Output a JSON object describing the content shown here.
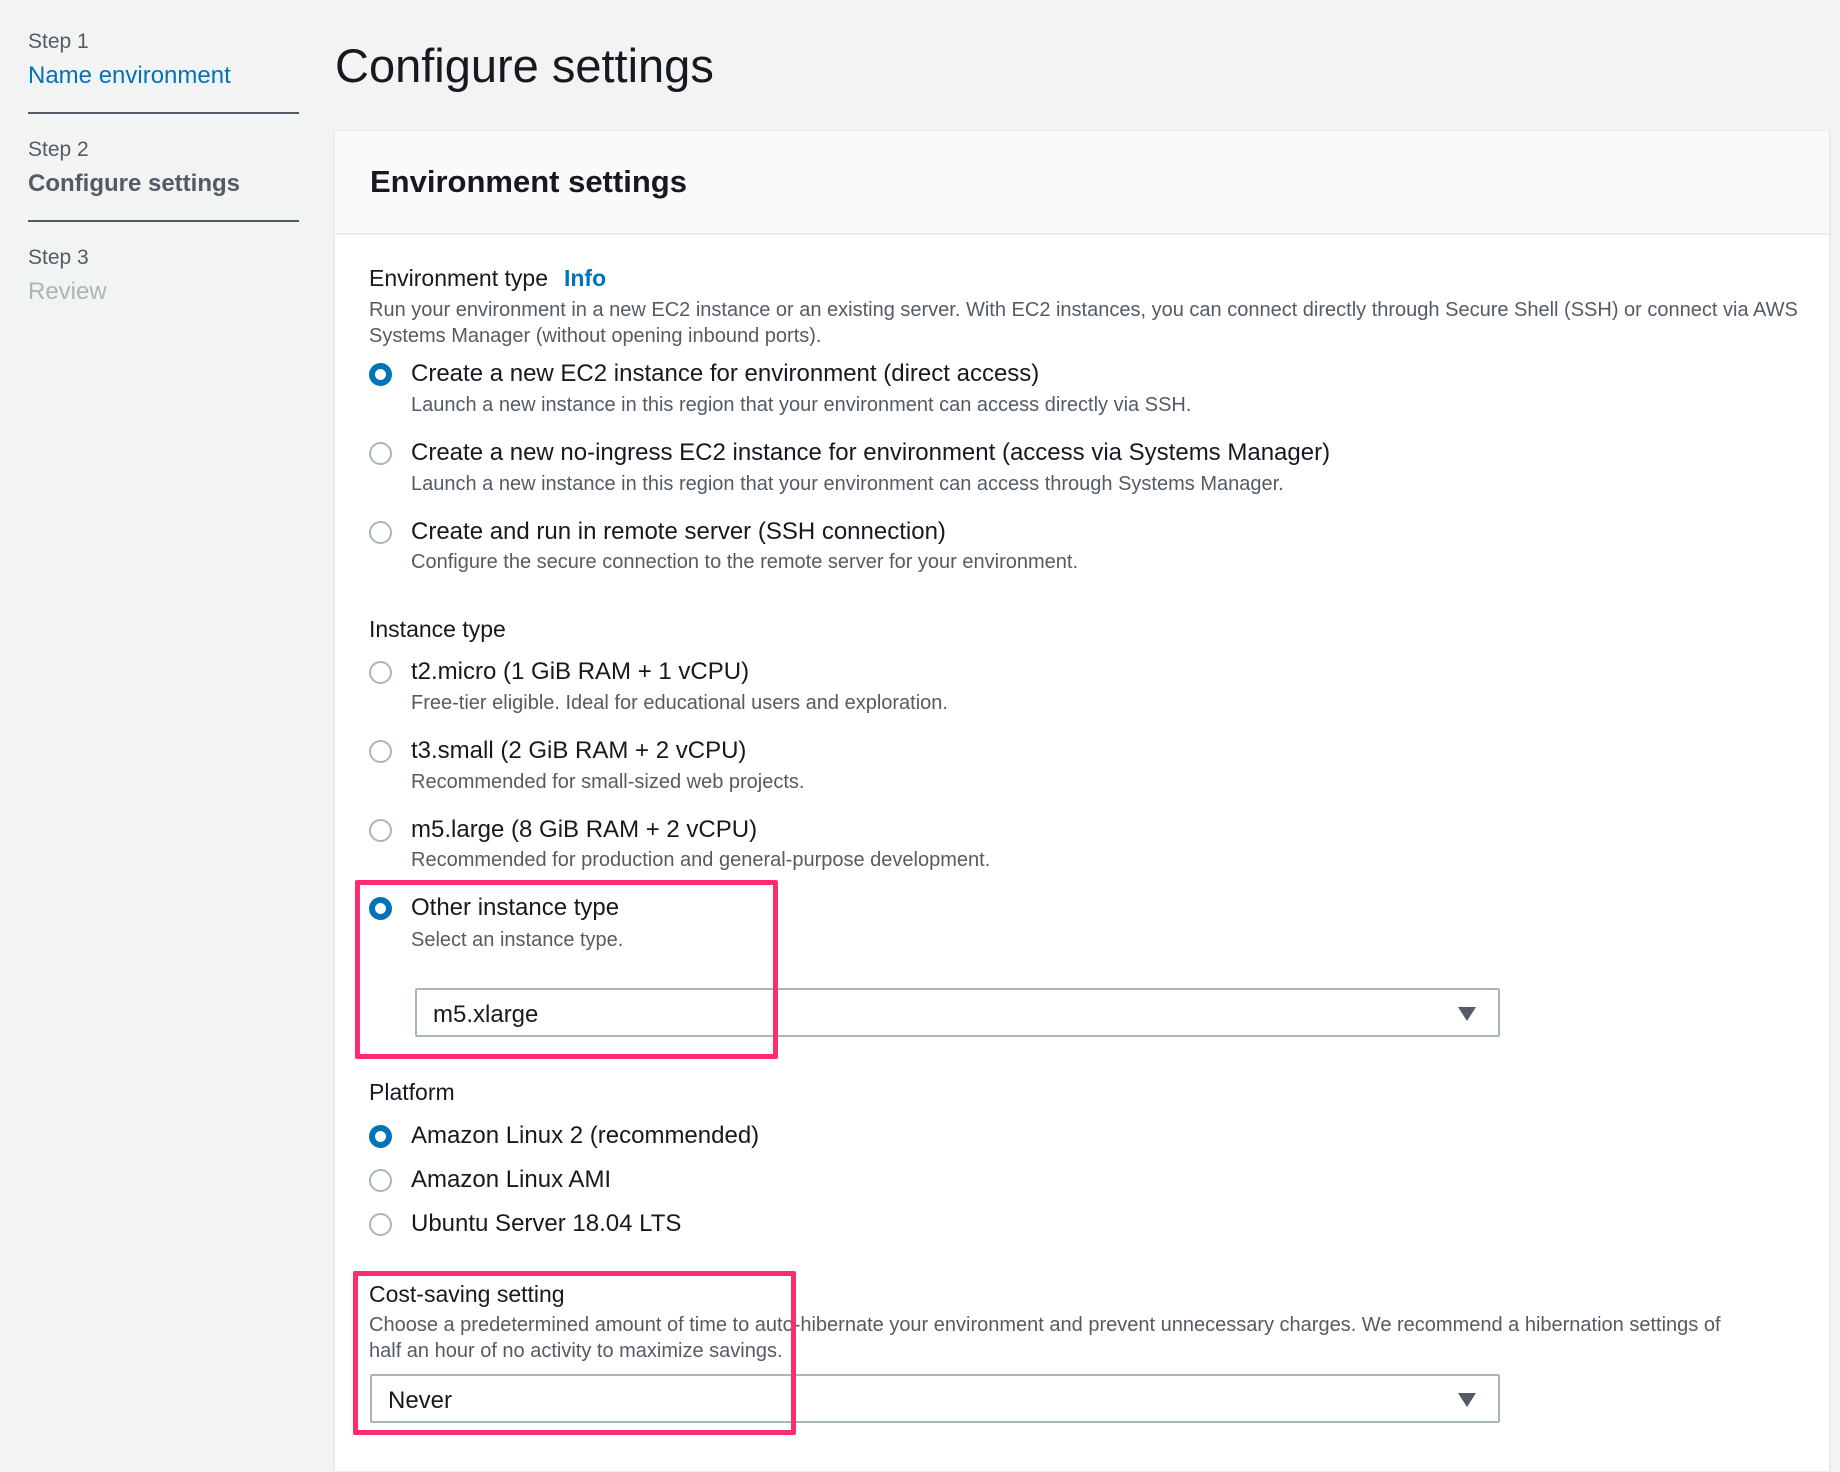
{
  "steps": [
    {
      "num": "Step 1",
      "label": "Name environment",
      "state": "link"
    },
    {
      "num": "Step 2",
      "label": "Configure settings",
      "state": "current"
    },
    {
      "num": "Step 3",
      "label": "Review",
      "state": "disabled"
    }
  ],
  "page_title": "Configure settings",
  "panel": {
    "title": "Environment settings",
    "env_type": {
      "label": "Environment type",
      "info": "Info",
      "description": "Run your environment in a new EC2 instance or an existing server. With EC2 instances, you can connect directly through Secure Shell (SSH) or connect via AWS Systems Manager (without opening inbound ports).",
      "options": [
        {
          "label": "Create a new EC2 instance for environment (direct access)",
          "desc": "Launch a new instance in this region that your environment can access directly via SSH.",
          "selected": true
        },
        {
          "label": "Create a new no-ingress EC2 instance for environment (access via Systems Manager)",
          "desc": "Launch a new instance in this region that your environment can access through Systems Manager.",
          "selected": false
        },
        {
          "label": "Create and run in remote server (SSH connection)",
          "desc": "Configure the secure connection to the remote server for your environment.",
          "selected": false
        }
      ]
    },
    "instance_type": {
      "label": "Instance type",
      "options": [
        {
          "label": "t2.micro (1 GiB RAM + 1 vCPU)",
          "desc": "Free-tier eligible. Ideal for educational users and exploration.",
          "selected": false
        },
        {
          "label": "t3.small (2 GiB RAM + 2 vCPU)",
          "desc": "Recommended for small-sized web projects.",
          "selected": false
        },
        {
          "label": "m5.large (8 GiB RAM + 2 vCPU)",
          "desc": "Recommended for production and general-purpose development.",
          "selected": false
        },
        {
          "label": "Other instance type",
          "desc": "Select an instance type.",
          "selected": true
        }
      ],
      "other_value": "m5.xlarge"
    },
    "platform": {
      "label": "Platform",
      "options": [
        {
          "label": "Amazon Linux 2 (recommended)",
          "selected": true
        },
        {
          "label": "Amazon Linux AMI",
          "selected": false
        },
        {
          "label": "Ubuntu Server 18.04 LTS",
          "selected": false
        }
      ]
    },
    "cost_saving": {
      "label": "Cost-saving setting",
      "description": "Choose a predetermined amount of time to auto-hibernate your environment and prevent unnecessary charges. We recommend a hibernation settings of half an hour of no activity to maximize savings.",
      "value": "Never"
    }
  },
  "colors": {
    "accent": "#0073bb",
    "highlight": "#ff2d6e"
  }
}
